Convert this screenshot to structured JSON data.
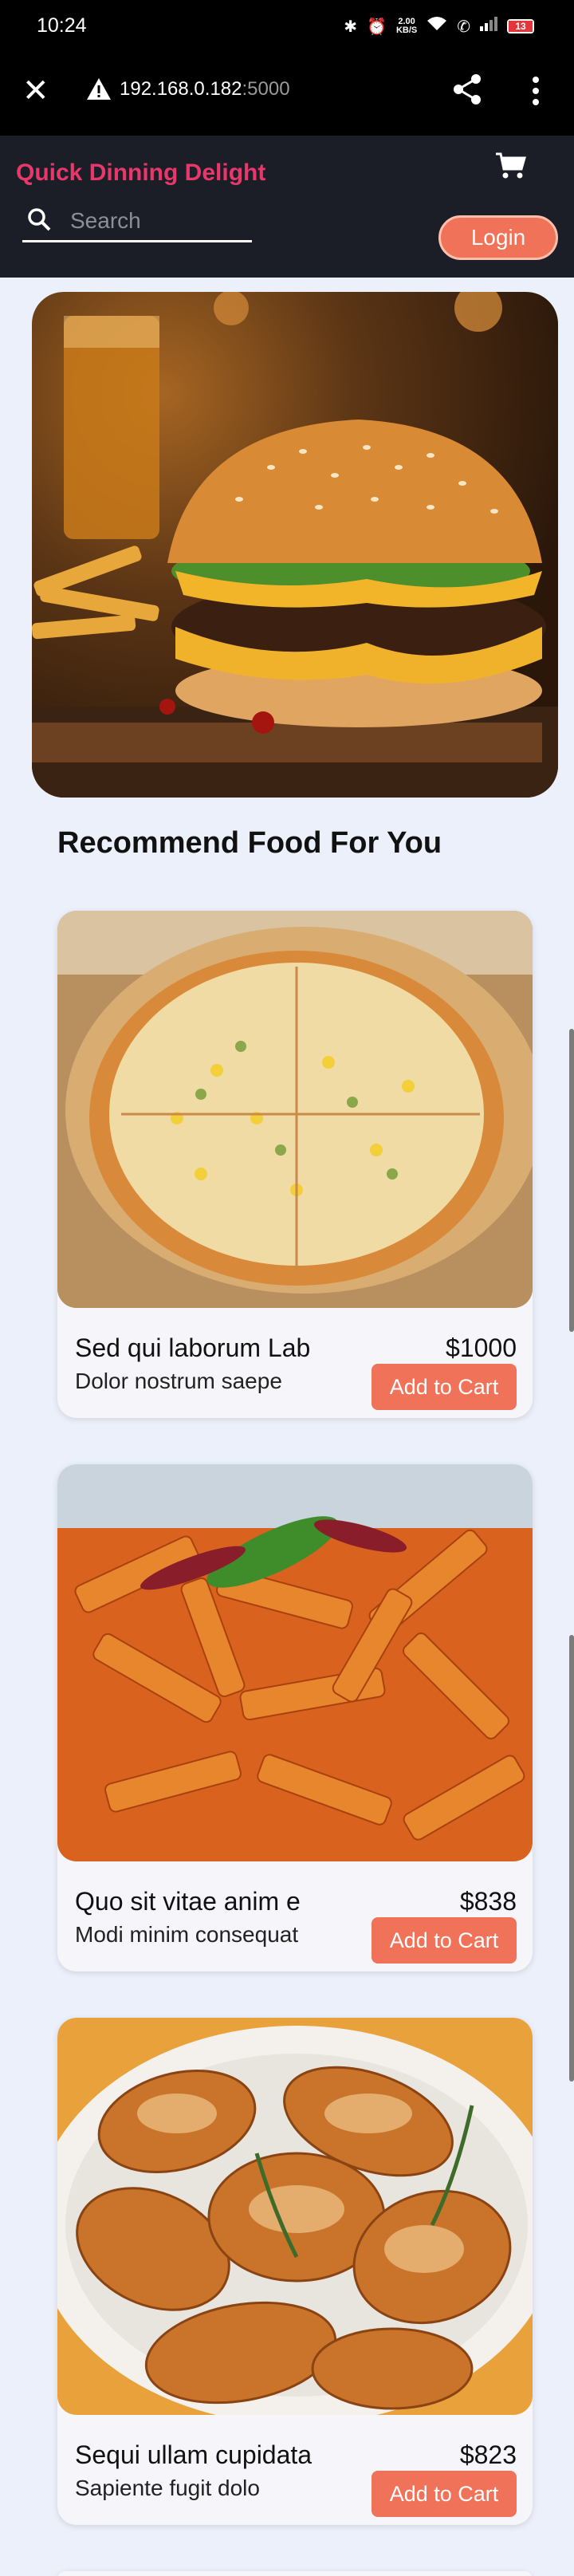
{
  "status_bar": {
    "time": "10:24",
    "net_speed_value": "2.00",
    "net_speed_unit": "KB/S",
    "battery": "13"
  },
  "browser": {
    "url_host": "192.168.0.182",
    "url_port": ":5000"
  },
  "header": {
    "brand": "Quick Dinning Delight",
    "search_placeholder": "Search",
    "login_label": "Login"
  },
  "section_title": "Recommend Food For You",
  "products": [
    {
      "name": "Sed qui laborum Lab",
      "description": "Dolor nostrum saepe",
      "price": "$1000",
      "button": "Add to Cart"
    },
    {
      "name": "Quo sit vitae anim e",
      "description": "Modi minim consequat",
      "price": "$838",
      "button": "Add to Cart"
    },
    {
      "name": "Sequi ullam cupidata",
      "description": "Sapiente fugit dolo",
      "price": "$823",
      "button": "Add to Cart"
    }
  ],
  "colors": {
    "accent": "#f07258",
    "brand": "#e8376b",
    "header_bg": "#1b1d27",
    "page_bg": "#ecf0fa"
  }
}
